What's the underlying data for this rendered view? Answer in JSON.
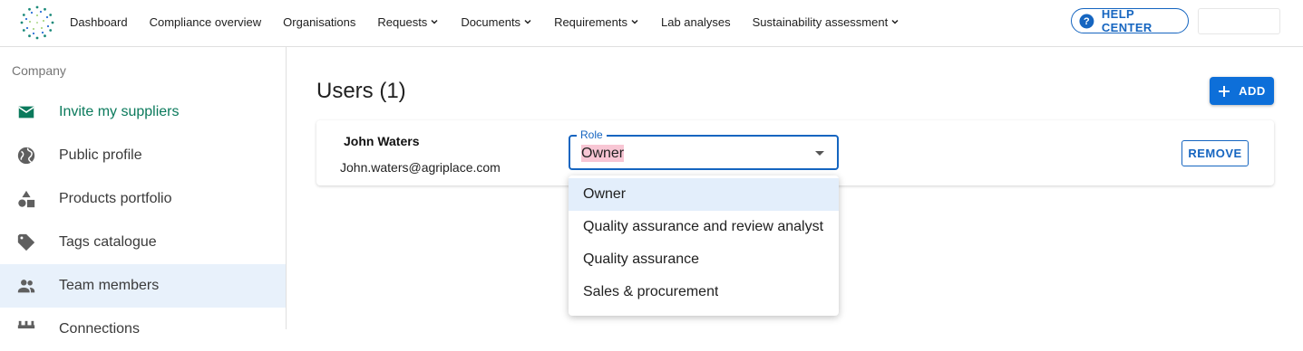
{
  "nav": {
    "items": [
      {
        "label": "Dashboard",
        "dropdown": false
      },
      {
        "label": "Compliance overview",
        "dropdown": false
      },
      {
        "label": "Organisations",
        "dropdown": false
      },
      {
        "label": "Requests",
        "dropdown": true
      },
      {
        "label": "Documents",
        "dropdown": true
      },
      {
        "label": "Requirements",
        "dropdown": true
      },
      {
        "label": "Lab analyses",
        "dropdown": false
      },
      {
        "label": "Sustainability assessment",
        "dropdown": true
      }
    ],
    "help_label": "HELP CENTER"
  },
  "sidebar": {
    "heading": "Company",
    "items": [
      {
        "label": "Invite my suppliers",
        "icon": "mail-icon"
      },
      {
        "label": "Public profile",
        "icon": "globe-icon"
      },
      {
        "label": "Products portfolio",
        "icon": "shapes-icon"
      },
      {
        "label": "Tags catalogue",
        "icon": "tag-icon"
      },
      {
        "label": "Team members",
        "icon": "people-icon"
      },
      {
        "label": "Connections",
        "icon": "connections-icon"
      }
    ]
  },
  "main": {
    "title": "Users (1)",
    "add_label": "ADD",
    "user": {
      "name": "John Waters",
      "email": "John.waters@agriplace.com",
      "role_label": "Role",
      "role_value": "Owner",
      "remove_label": "REMOVE"
    },
    "role_options": [
      "Owner",
      "Quality assurance and review analyst",
      "Quality assurance",
      "Sales & procurement"
    ]
  },
  "colors": {
    "accent": "#1565c0",
    "primary_button": "#0d6fd9",
    "active_nav_bg": "#e8f1fb",
    "green_text": "#0b7a5c",
    "highlight": "#f8c6d4"
  }
}
